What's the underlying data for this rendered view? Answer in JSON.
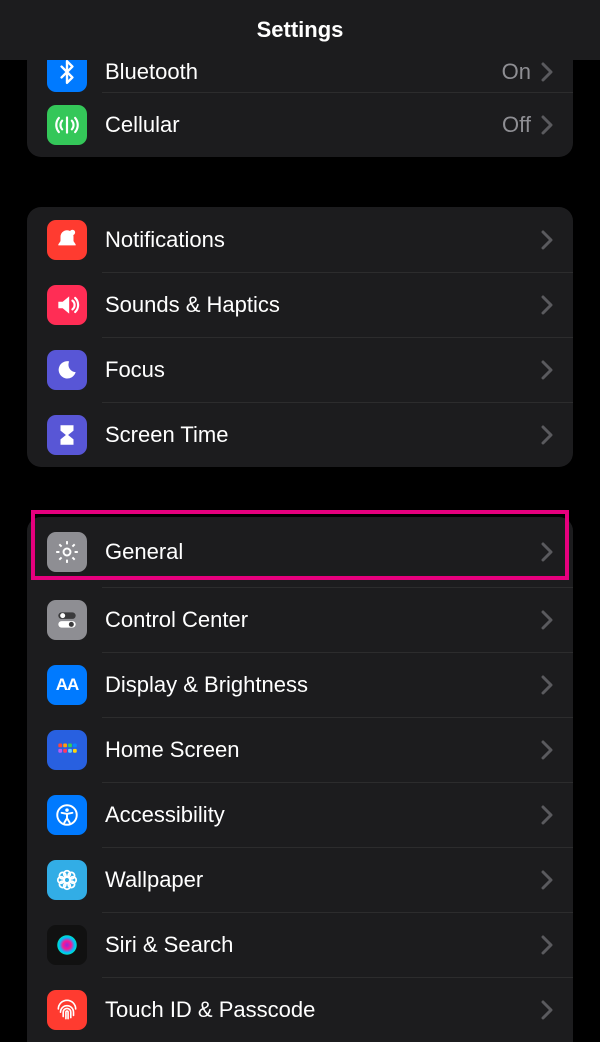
{
  "header": {
    "title": "Settings"
  },
  "groups": {
    "connectivity": {
      "bluetooth": {
        "label": "Bluetooth",
        "value": "On"
      },
      "cellular": {
        "label": "Cellular",
        "value": "Off"
      }
    },
    "alerts": {
      "notifications": {
        "label": "Notifications"
      },
      "sounds": {
        "label": "Sounds & Haptics"
      },
      "focus": {
        "label": "Focus"
      },
      "screentime": {
        "label": "Screen Time"
      }
    },
    "device": {
      "general": {
        "label": "General"
      },
      "control": {
        "label": "Control Center"
      },
      "display": {
        "label": "Display & Brightness"
      },
      "home": {
        "label": "Home Screen"
      },
      "accessibility": {
        "label": "Accessibility"
      },
      "wallpaper": {
        "label": "Wallpaper"
      },
      "siri": {
        "label": "Siri & Search"
      },
      "touchid": {
        "label": "Touch ID & Passcode"
      }
    }
  },
  "highlight": {
    "target": "general"
  }
}
